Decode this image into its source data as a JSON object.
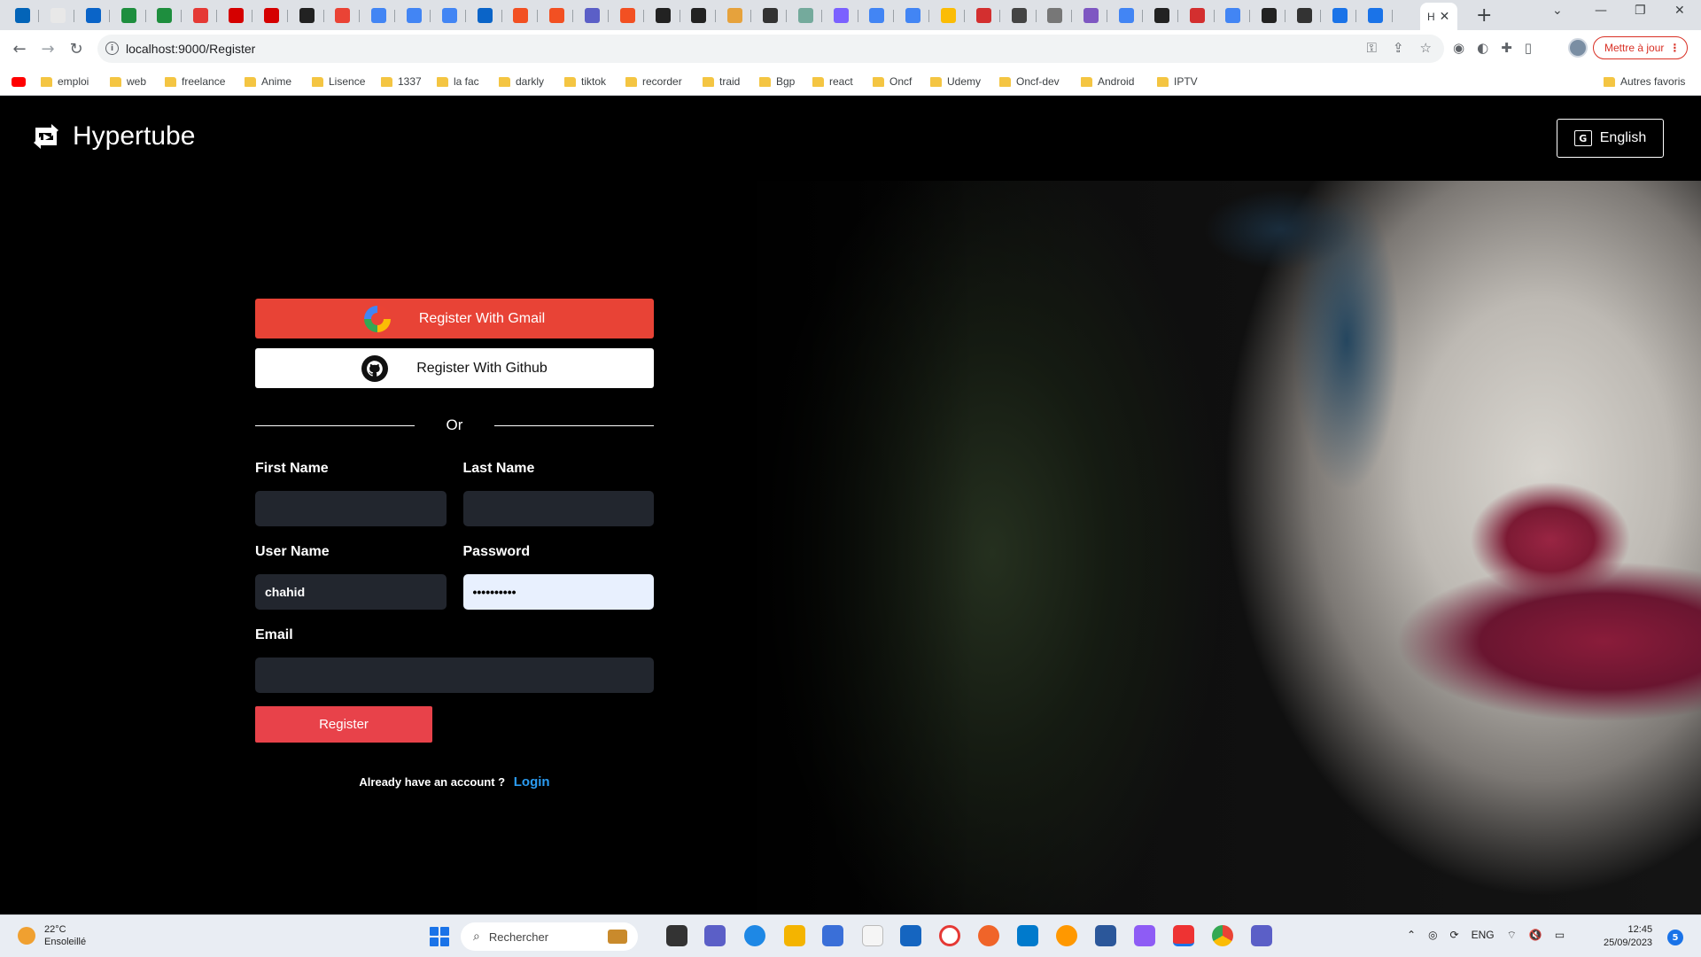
{
  "browser": {
    "active_tab_title": "H",
    "tab_icons": [
      "outlook-icon",
      "paint-icon",
      "onedrive-icon",
      "sheets-icon",
      "sheets-icon",
      "red-dot-icon",
      "x-icon",
      "x-icon",
      "github-icon",
      "gmail-icon",
      "google-icon",
      "translate-icon",
      "translate-icon",
      "onedrive-icon",
      "microsoft-icon",
      "microsoft-icon",
      "teams-icon",
      "microsoft-icon",
      "roblox-icon",
      "roblox-icon",
      "chart-icon",
      "pdf-icon",
      "chatgpt-icon",
      "star-icon",
      "google-icon",
      "google-icon",
      "drive-icon",
      "flag-icon",
      "globe-icon",
      "bls-icon",
      "purple-icon",
      "google-icon",
      "youtube-icon",
      "red-icon",
      "google-icon",
      "dark-icon",
      "pdf-icon",
      "info-icon",
      "info-icon"
    ],
    "url": "localhost:9000/Register",
    "update_label": "Mettre à jour",
    "bookmarks": [
      "emploi",
      "web",
      "freelance",
      "Anime",
      "Lisence",
      "1337",
      "la fac",
      "darkly",
      "tiktok",
      "recorder",
      "traid",
      "Bgp",
      "react",
      "Oncf",
      "Udemy",
      "Oncf-dev",
      "Android",
      "IPTV"
    ],
    "other_bookmarks": "Autres favoris"
  },
  "site": {
    "brand": "Hypertube",
    "language": "English"
  },
  "form": {
    "gmail_label": "Register With Gmail",
    "github_label": "Register With Github",
    "divider": "Or",
    "first_name_label": "First Name",
    "first_name_value": "",
    "last_name_label": "Last Name",
    "last_name_value": "",
    "username_label": "User Name",
    "username_value": "chahid",
    "password_label": "Password",
    "password_value": "••••••••••",
    "email_label": "Email",
    "email_value": "",
    "submit_label": "Register",
    "account_prompt": "Already have an account ?",
    "login_label": "Login"
  },
  "taskbar": {
    "temperature": "22°C",
    "weather": "Ensoleillé",
    "search_placeholder": "Rechercher",
    "language": "ENG",
    "time": "12:45",
    "date": "25/09/2023",
    "notifications": "5"
  }
}
